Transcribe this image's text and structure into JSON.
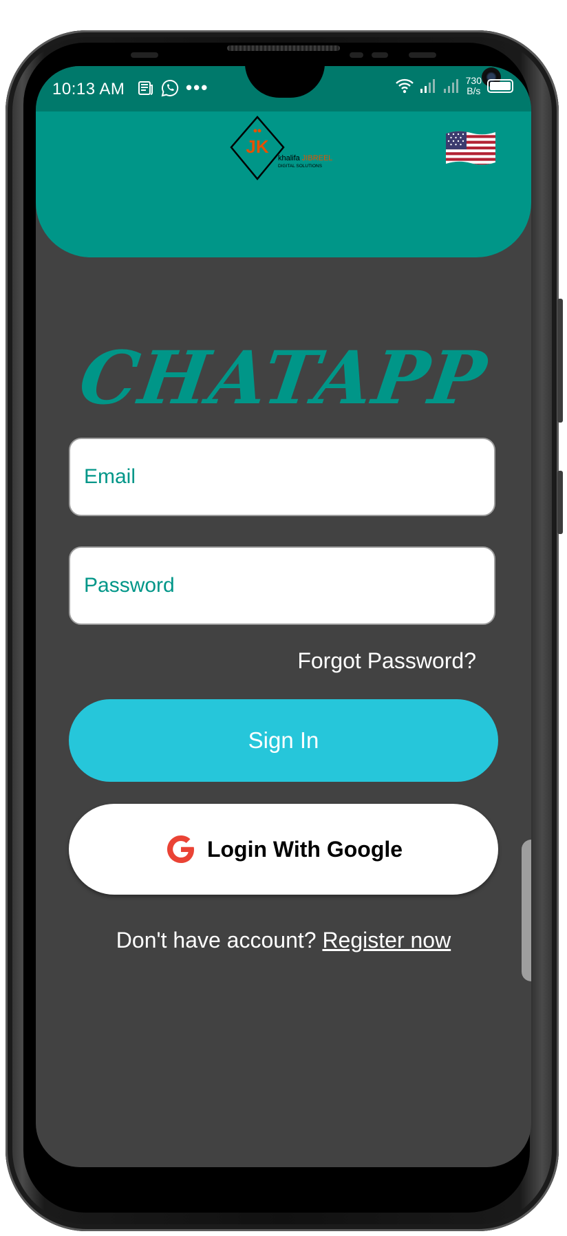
{
  "status_bar": {
    "time": "10:13 AM",
    "more_icon": "•••",
    "net_speed_value": "730",
    "net_speed_unit": "B/s",
    "icons_left": [
      "news-icon",
      "whatsapp-icon",
      "more-dots-icon"
    ],
    "icons_right": [
      "wifi-icon",
      "signal-icon",
      "signal-icon-2",
      "battery-icon"
    ]
  },
  "header": {
    "logo_text_1": "khalifa",
    "logo_text_2": "JIBREEL",
    "logo_subtext": "DIGITAL SOLUTIONS",
    "logo_letters": "JK",
    "language_flag": "us-flag-icon"
  },
  "login": {
    "app_title": "CHATAPP",
    "email_placeholder": "Email",
    "password_placeholder": "Password",
    "forgot_password": "Forgot Password?",
    "sign_in": "Sign In",
    "google_login": "Login With Google",
    "no_account_text": "Don't have account?",
    "register_link": "Register now"
  },
  "colors": {
    "status_bar": "#00796b",
    "header": "#009688",
    "background": "#424242",
    "accent": "#009688",
    "sign_in_button": "#26c6da",
    "google_red": "#ea4335"
  }
}
